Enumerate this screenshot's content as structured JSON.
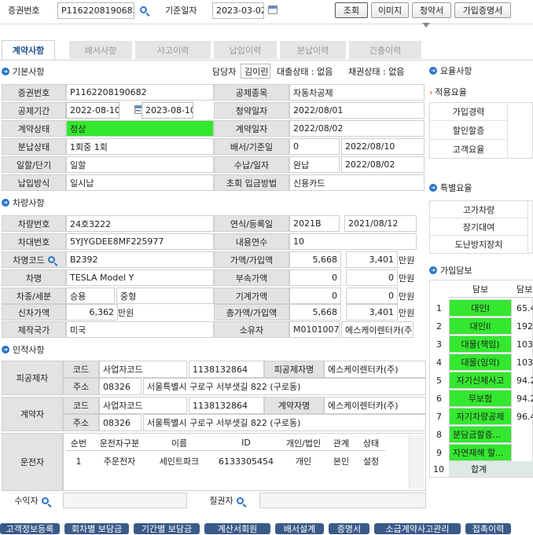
{
  "top": {
    "policy_no_label": "증권번호",
    "policy_no": "P1162208190682",
    "base_date_label": "기준일자",
    "base_date": "2023-03-02",
    "btn_search": "조회",
    "btn_image": "이미지",
    "btn_claim": "청약서",
    "btn_cert": "가입증명서"
  },
  "tabs": [
    "계약사항",
    "배서사항",
    "사고이력",
    "납입이력",
    "분납이력",
    "긴출이력"
  ],
  "basic": {
    "title": "기본사항",
    "manager_label": "담당자",
    "manager": "김이린",
    "loan_status": "대출상태 : 없음",
    "bond_status": "채권상태 : 없음",
    "policy_no_label": "증권번호",
    "policy_no": "P1162208190682",
    "type_label": "공제종목",
    "type": "자동차공제",
    "period_label": "공제기간",
    "period_from": "2022-08-10",
    "tilde": "~",
    "period_to": "2023-08-10",
    "apply_date_label": "청약일자",
    "apply_date": "2022/08/01",
    "status_label": "계약상태",
    "status": "정상",
    "contract_date_label": "계약일자",
    "contract_date": "2022/08/02",
    "inst_label": "분납상태",
    "inst": "1회중 1회",
    "endorse_label": "배서/기준일",
    "endorse_no": "0",
    "endorse_date": "2022/08/10",
    "term_label": "일할/단기",
    "term": "일할",
    "receipt_label": "수납/일자",
    "receipt": "완납",
    "receipt_date": "2022/08/02",
    "pay_label": "납입방식",
    "pay": "일시납",
    "first_pay_label": "초회 입금방법",
    "first_pay": "신용카드"
  },
  "car": {
    "title": "차량사항",
    "car_no_label": "차량번호",
    "car_no": "24호3222",
    "year_label": "연식/등록일",
    "year": "2021B",
    "reg_date": "2021/08/12",
    "vin_label": "차대번호",
    "vin": "5YJYGDEE8MF225977",
    "years_label": "내용연수",
    "years": "10",
    "model_code_label": "차명코드",
    "model_code": "B2392",
    "value_label": "가액/가입액",
    "value": "5,668",
    "value_join": "3,401",
    "unit": "만원",
    "model_label": "차명",
    "model": "TESLA Model Y",
    "acc_label": "부속가액",
    "acc": "0",
    "acc_join": "0",
    "kind_label": "차종/세분",
    "kind": "승용",
    "kind_sub": "중형",
    "mech_label": "기계가액",
    "mech": "0",
    "mech_join": "0",
    "new_price_label": "신차가액",
    "new_price": "6,362",
    "total_label": "총가액/가입액",
    "total": "5,668",
    "total_join": "3,401",
    "country_label": "제작국가",
    "country": "미국",
    "owner_label": "소유자",
    "owner_code": "M01010077",
    "owner": "에스케이렌터카(주"
  },
  "person": {
    "title": "인적사항",
    "insured_label": "피공제자",
    "code_label": "코드",
    "code_type": "사업자코드",
    "code": "1138132864",
    "insured_name_label": "피공제자명",
    "insured_name": "에스케이렌터카(주)",
    "addr_label": "주소",
    "zip": "08326",
    "addr": "서울특별시 구로구 서부샛길 822 (구로동)",
    "contractor_label": "계약자",
    "contractor_name_label": "계약자명",
    "contractor_name": "에스케이렌터카(주)",
    "driver_label": "운전자",
    "driver_cols": [
      "순번",
      "운전자구분",
      "이름",
      "ID",
      "개인/법인",
      "관계",
      "상태"
    ],
    "driver_row": [
      "1",
      "주운전자",
      "세인트파크",
      "6133305454",
      "개인",
      "본인",
      "설정"
    ],
    "beneficiary_label": "수익자",
    "pledgee_label": "질권자"
  },
  "rate": {
    "title": "요율사항",
    "applied": "적용요율",
    "items": [
      "가입경력",
      "할인할증",
      "고객요율"
    ],
    "special_title": "특별요율",
    "special": [
      "고가차량",
      "장기대여",
      "도난방지장치"
    ]
  },
  "cover": {
    "title": "가입담보",
    "col_cover": "담보",
    "col_amount": "담보",
    "rows": [
      [
        "1",
        "대인I",
        "65.4"
      ],
      [
        "2",
        "대인II",
        "192.1"
      ],
      [
        "3",
        "대물(책임)",
        "103"
      ],
      [
        "4",
        "대물(임의)",
        "103"
      ],
      [
        "5",
        "자기신체사고",
        "94.2"
      ],
      [
        "6",
        "무보험",
        "94.2"
      ],
      [
        "7",
        "자기차량공제",
        "96.4"
      ],
      [
        "8",
        "분담금할증...",
        ""
      ],
      [
        "9",
        "자연재해 할...",
        ""
      ],
      [
        "10",
        "합계",
        ""
      ]
    ]
  },
  "bottom": [
    "고객정보등록",
    "회차별 보담금",
    "기간별 보담금",
    "계산서회원",
    "배서설계",
    "증명서",
    "소급계약사고관리",
    "접촉이력"
  ]
}
